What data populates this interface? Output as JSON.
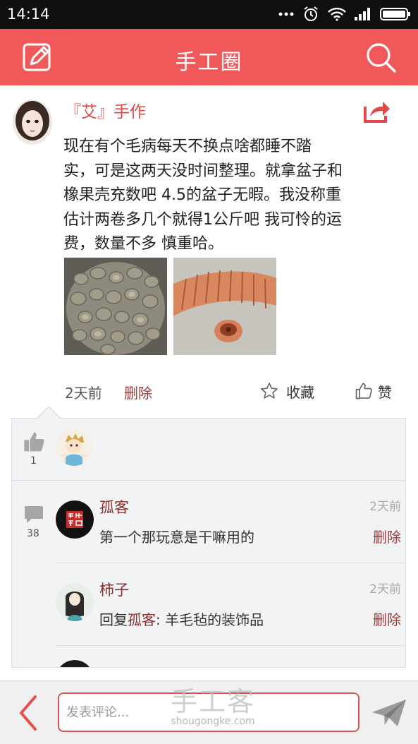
{
  "status_bar": {
    "time": "14:14",
    "icons": [
      "dots-icon",
      "alarm-icon",
      "wifi-icon",
      "signal-icon",
      "battery-icon"
    ]
  },
  "app_bar": {
    "title": "手工圈",
    "left_icon": "edit-icon",
    "right_icon": "search-icon",
    "color": "#f1585a"
  },
  "post": {
    "author": "『艾』手作",
    "text_lines": [
      "现在有个毛病每天不换点啥都睡不踏",
      "实，可是这两天没时间整理。就拿盆子和",
      "橡果壳充数吧 4.5的盆子无暇。我没称重",
      "估计两卷多几个就得1公斤吧 我可怜的运",
      "费，数量不多 慎重哈。"
    ],
    "time": "2天前",
    "delete_label": "删除",
    "favorite_label": "收藏",
    "like_label": "赞",
    "share_icon": "share-icon"
  },
  "likes": {
    "count": "1"
  },
  "comments": {
    "count": "38",
    "items": [
      {
        "name": "孤客",
        "time": "2天前",
        "text": "第一个那玩意是干嘛用的",
        "delete_label": "删除"
      },
      {
        "name": "柿子",
        "time": "2天前",
        "reply_prefix": "回复",
        "reply_to": "孤客",
        "reply_text": ": 羊毛毡的装饰品",
        "delete_label": "删除"
      }
    ]
  },
  "bottom_bar": {
    "placeholder": "发表评论...",
    "back_icon": "back-arrow-icon",
    "send_icon": "send-icon"
  },
  "watermark": {
    "big": "手工客",
    "small": "shougongke.com"
  },
  "colors": {
    "accent": "#f1585a",
    "author": "#e24848",
    "link": "#8e2f2f"
  }
}
